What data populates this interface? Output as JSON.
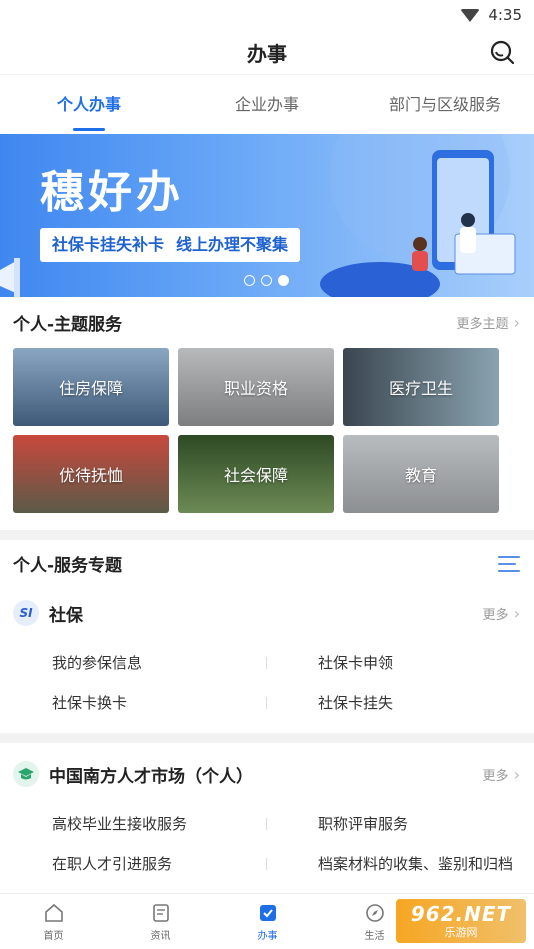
{
  "status": {
    "time": "4:35"
  },
  "header": {
    "title": "办事"
  },
  "tabs": [
    {
      "label": "个人办事",
      "active": true
    },
    {
      "label": "企业办事",
      "active": false
    },
    {
      "label": "部门与区级服务",
      "active": false
    }
  ],
  "banner": {
    "title": "穗好办",
    "sub_left": "社保卡挂失补卡",
    "sub_right": "线上办理不聚集",
    "page_index": 3,
    "page_count": 3
  },
  "theme_section": {
    "title": "个人-主题服务",
    "more": "更多主题",
    "tiles": [
      {
        "label": "住房保障",
        "color": "#5a7a96"
      },
      {
        "label": "职业资格",
        "color": "#8f9294"
      },
      {
        "label": "医疗卫生",
        "color": "#5f7784"
      },
      {
        "label": "优待抚恤",
        "color": "#b24a3e"
      },
      {
        "label": "社会保障",
        "color": "#4c6a3b"
      },
      {
        "label": "教育",
        "color": "#9a9ea2"
      }
    ]
  },
  "service_section": {
    "title": "个人-服务专题"
  },
  "groups": [
    {
      "icon_text": "SI",
      "title": "社保",
      "more": "更多",
      "items": [
        "我的参保信息",
        "社保卡申领",
        "社保卡换卡",
        "社保卡挂失"
      ]
    },
    {
      "title": "中国南方人才市场（个人）",
      "more": "更多",
      "items": [
        "高校毕业生接收服务",
        "职称评审服务",
        "在职人才引进服务",
        "档案材料的收集、鉴别和归档"
      ]
    }
  ],
  "nav": [
    {
      "label": "首页",
      "active": false
    },
    {
      "label": "资讯",
      "active": false
    },
    {
      "label": "办事",
      "active": true
    },
    {
      "label": "生活",
      "active": false
    }
  ],
  "watermark": {
    "main": "962.NET",
    "sub": "乐游网"
  },
  "colors": {
    "accent": "#1e6ee8"
  }
}
